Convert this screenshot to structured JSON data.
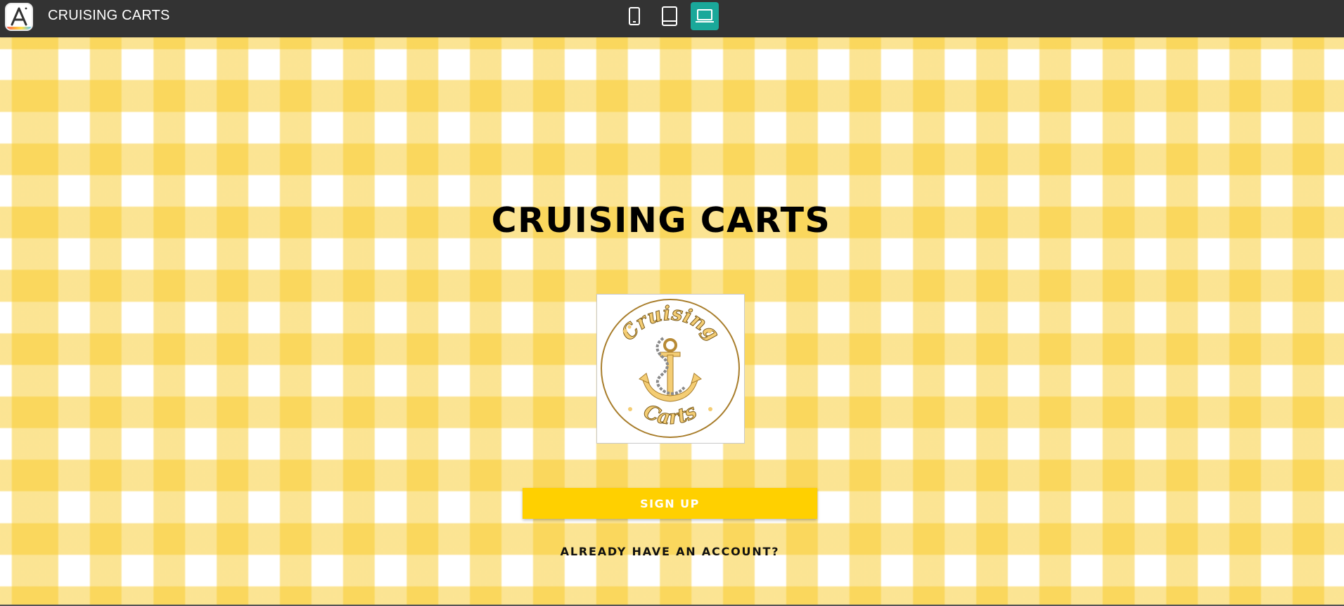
{
  "topbar": {
    "app_title": "CRUISING CARTS",
    "logo_icon": "app-maker-logo-icon",
    "device_buttons": [
      {
        "icon": "phone-icon",
        "active": false
      },
      {
        "icon": "tablet-icon",
        "active": false
      },
      {
        "icon": "laptop-icon",
        "active": true
      }
    ],
    "accent_color": "#1aa89a",
    "bar_color": "#333333"
  },
  "main": {
    "headline": "CRUISING CARTS",
    "logo": {
      "top_text": "Cruising",
      "bottom_text": "Carts",
      "icon": "anchor-icon"
    },
    "signup_label": "SIGN UP",
    "login_label": "ALREADY HAVE AN ACCOUNT?",
    "button_color": "#ffd000",
    "background_pattern": "yellow-gingham"
  }
}
